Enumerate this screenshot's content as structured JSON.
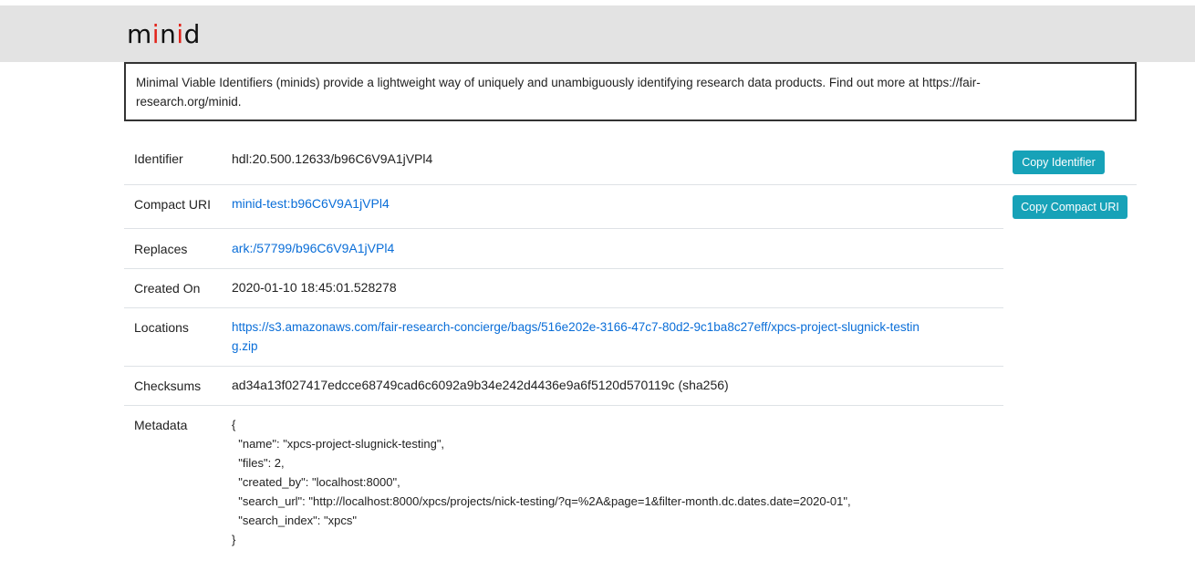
{
  "header": {
    "logo_parts": [
      "m",
      "i",
      "n",
      "i",
      "d"
    ]
  },
  "about": {
    "text": "Minimal Viable Identifiers (minids) provide a lightweight way of uniquely and unambiguously identifying research data products. Find out more at https://fair-research.org/minid."
  },
  "details": {
    "identifier": {
      "label": "Identifier",
      "value": "hdl:20.500.12633/b96C6V9A1jVPl4"
    },
    "compact_uri": {
      "label": "Compact URI",
      "value": "minid-test:b96C6V9A1jVPl4"
    },
    "replaces": {
      "label": "Replaces",
      "value": "ark:/57799/b96C6V9A1jVPl4"
    },
    "created_on": {
      "label": "Created On",
      "value": "2020-01-10 18:45:01.528278"
    },
    "locations": {
      "label": "Locations",
      "value_line1": "https://s3.amazonaws.com/fair-research-concierge/bags/516e202e-3166-47c7-80d2-9c1ba8c27eff/xpcs-project-slugnick-testin",
      "value_line2": "g.zip"
    },
    "checksums": {
      "label": "Checksums",
      "value": "ad34a13f027417edcce68749cad6c6092a9b34e242d4436e9a6f5120d570119c (sha256)"
    },
    "metadata": {
      "label": "Metadata",
      "lines": [
        "{",
        "  \"name\": \"xpcs-project-slugnick-testing\",",
        "  \"files\": 2,",
        "  \"created_by\": \"localhost:8000\",",
        "  \"search_url\": \"http://localhost:8000/xpcs/projects/nick-testing/?q=%2A&page=1&filter-month.dc.dates.date=2020-01\",",
        "  \"search_index\": \"xpcs\"",
        "}"
      ]
    }
  },
  "buttons": {
    "copy_identifier": "Copy Identifier",
    "copy_compact_uri": "Copy Compact URI"
  },
  "colors": {
    "accent": "#17a2b8",
    "link": "#0a6ed8",
    "logo_red": "#e2231a",
    "header_bg": "#e3e3e3"
  }
}
